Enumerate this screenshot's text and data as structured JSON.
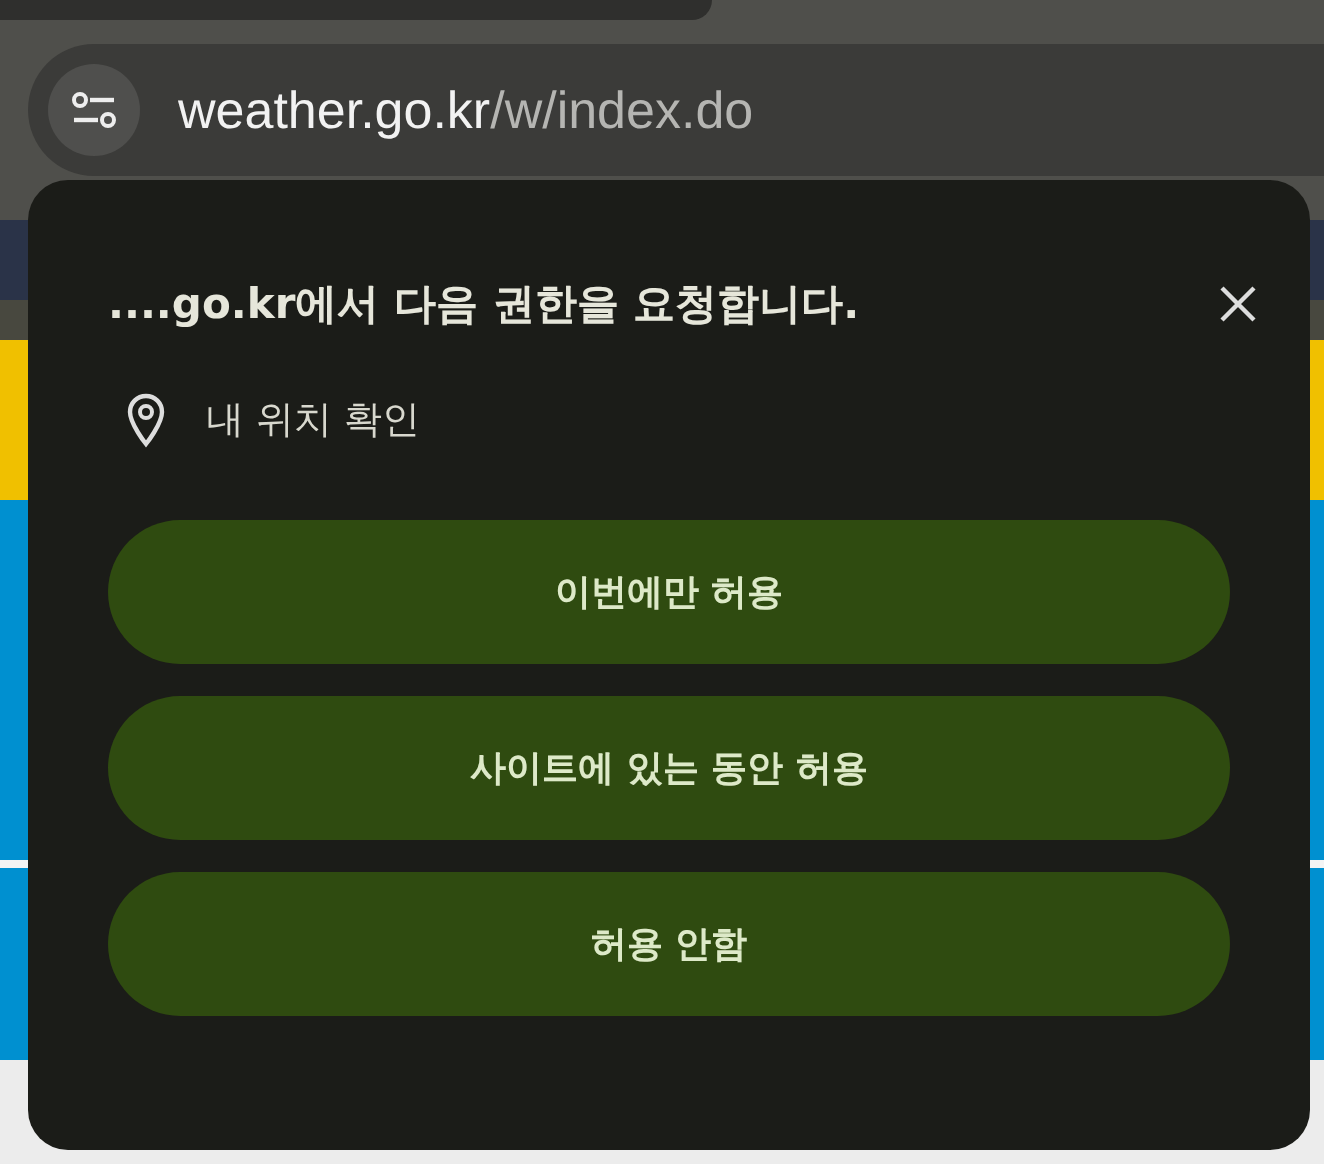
{
  "address_bar": {
    "host": "weather.go.kr",
    "path": "/w/index.do"
  },
  "permission_popup": {
    "title": "....go.kr에서 다음 권한을 요청합니다.",
    "permission": "내 위치 확인",
    "buttons": [
      "이번에만 허용",
      "사이트에 있는 동안 허용",
      "허용 안함"
    ]
  }
}
